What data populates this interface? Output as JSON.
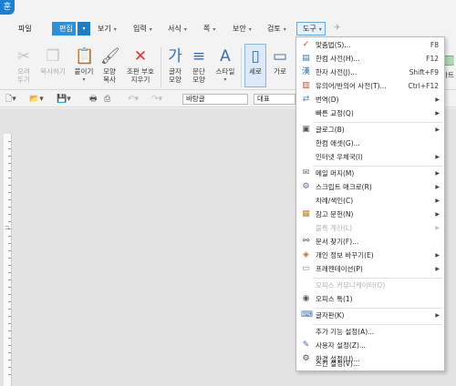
{
  "app": {
    "logo_glyph": "훈"
  },
  "menubar": {
    "tabs": [
      {
        "label": "파일",
        "has_arrow": false
      },
      {
        "label": "편집",
        "has_arrow": true
      },
      {
        "label": "보기",
        "has_arrow": true
      },
      {
        "label": "입력",
        "has_arrow": true
      },
      {
        "label": "서식",
        "has_arrow": true
      },
      {
        "label": "쪽",
        "has_arrow": true
      },
      {
        "label": "보안",
        "has_arrow": true
      },
      {
        "label": "검토",
        "has_arrow": true
      },
      {
        "label": "도구",
        "has_arrow": true
      }
    ]
  },
  "ribbon": {
    "buttons": [
      {
        "label": "오려\n두기",
        "icon": "scissors-icon",
        "enabled": false
      },
      {
        "label": "복사하기",
        "icon": "copy-icon",
        "enabled": false
      },
      {
        "label": "붙이기",
        "icon": "paste-icon",
        "enabled": true
      },
      {
        "label": "모양\n복사",
        "icon": "format-painter-icon",
        "enabled": true
      },
      {
        "label": "조판 부호\n지우기",
        "icon": "clear-marks-icon",
        "enabled": true
      },
      {
        "label": "글자\n모양",
        "icon": "char-shape-icon",
        "enabled": true
      },
      {
        "label": "문단\n모양",
        "icon": "para-shape-icon",
        "enabled": true
      },
      {
        "label": "스타일",
        "icon": "style-icon",
        "enabled": true
      },
      {
        "label": "세로",
        "icon": "portrait-icon",
        "enabled": true
      },
      {
        "label": "가로",
        "icon": "landscape-icon",
        "enabled": true
      }
    ],
    "right_partial": "차트"
  },
  "toolbar2": {
    "style_value": "바탕글",
    "font_value": "대표"
  },
  "tools_menu": {
    "items": [
      {
        "label": "맞춤법(S)...",
        "shortcut": "F8",
        "icon": "spellcheck-icon",
        "submenu": false,
        "disabled": false
      },
      {
        "label": "한컴 사전(H)...",
        "shortcut": "F12",
        "icon": "dictionary-icon",
        "submenu": false,
        "disabled": false
      },
      {
        "label": "한자 사전(J)...",
        "shortcut": "Shift+F9",
        "icon": "hanja-dict-icon",
        "submenu": false,
        "disabled": false
      },
      {
        "label": "유의어/반의어 사전(T)...",
        "shortcut": "Ctrl+F12",
        "icon": "thesaurus-icon",
        "submenu": false,
        "disabled": false
      },
      {
        "label": "번역(D)",
        "shortcut": "",
        "icon": "translate-icon",
        "submenu": true,
        "disabled": false
      },
      {
        "label": "빠른 교정(Q)",
        "shortcut": "",
        "icon": "",
        "submenu": true,
        "disabled": false
      },
      {
        "label": "글로그(B)",
        "shortcut": "",
        "icon": "blog-icon",
        "submenu": true,
        "disabled": false
      },
      {
        "label": "한컴 애셋(G)...",
        "shortcut": "",
        "icon": "",
        "submenu": false,
        "disabled": false
      },
      {
        "label": "인터넷 우체국(I)",
        "shortcut": "",
        "icon": "",
        "submenu": true,
        "disabled": false
      },
      {
        "label": "메일 머지(M)",
        "shortcut": "",
        "icon": "mail-icon",
        "submenu": true,
        "disabled": false
      },
      {
        "label": "스크립트 매크로(R)",
        "shortcut": "",
        "icon": "macro-icon",
        "submenu": true,
        "disabled": false
      },
      {
        "label": "차례/색인(C)",
        "shortcut": "",
        "icon": "",
        "submenu": true,
        "disabled": false
      },
      {
        "label": "참고 문헌(N)",
        "shortcut": "",
        "icon": "references-icon",
        "submenu": true,
        "disabled": false
      },
      {
        "label": "블록 계산(L)",
        "shortcut": "",
        "icon": "",
        "submenu": true,
        "disabled": true
      },
      {
        "label": "문서 찾기(F)...",
        "shortcut": "",
        "icon": "binoculars-icon",
        "submenu": false,
        "disabled": false
      },
      {
        "label": "개인 정보 바꾸기(E)",
        "shortcut": "",
        "icon": "privacy-icon",
        "submenu": true,
        "disabled": false
      },
      {
        "label": "프레젠테이션(P)",
        "shortcut": "",
        "icon": "presentation-icon",
        "submenu": true,
        "disabled": false
      },
      {
        "label": "오피스 커뮤니케이터(O)",
        "shortcut": "",
        "icon": "",
        "submenu": false,
        "disabled": true
      },
      {
        "label": "오피스 톡(1)",
        "shortcut": "",
        "icon": "talk-icon",
        "submenu": false,
        "disabled": false
      },
      {
        "label": "글자판(K)",
        "shortcut": "",
        "icon": "keyboard-icon",
        "submenu": true,
        "disabled": false
      },
      {
        "label": "추가 기능 설정(A)...",
        "shortcut": "",
        "icon": "",
        "submenu": false,
        "disabled": false
      },
      {
        "label": "사용자 설정(Z)...",
        "shortcut": "",
        "icon": "user-settings-icon",
        "submenu": false,
        "disabled": false
      },
      {
        "label": "환경 설정(U)...",
        "shortcut": "",
        "icon": "gear-icon",
        "submenu": false,
        "disabled": false
      },
      {
        "label": "스킨 설정(V)...",
        "shortcut": "",
        "icon": "",
        "submenu": false,
        "disabled": false
      }
    ]
  }
}
